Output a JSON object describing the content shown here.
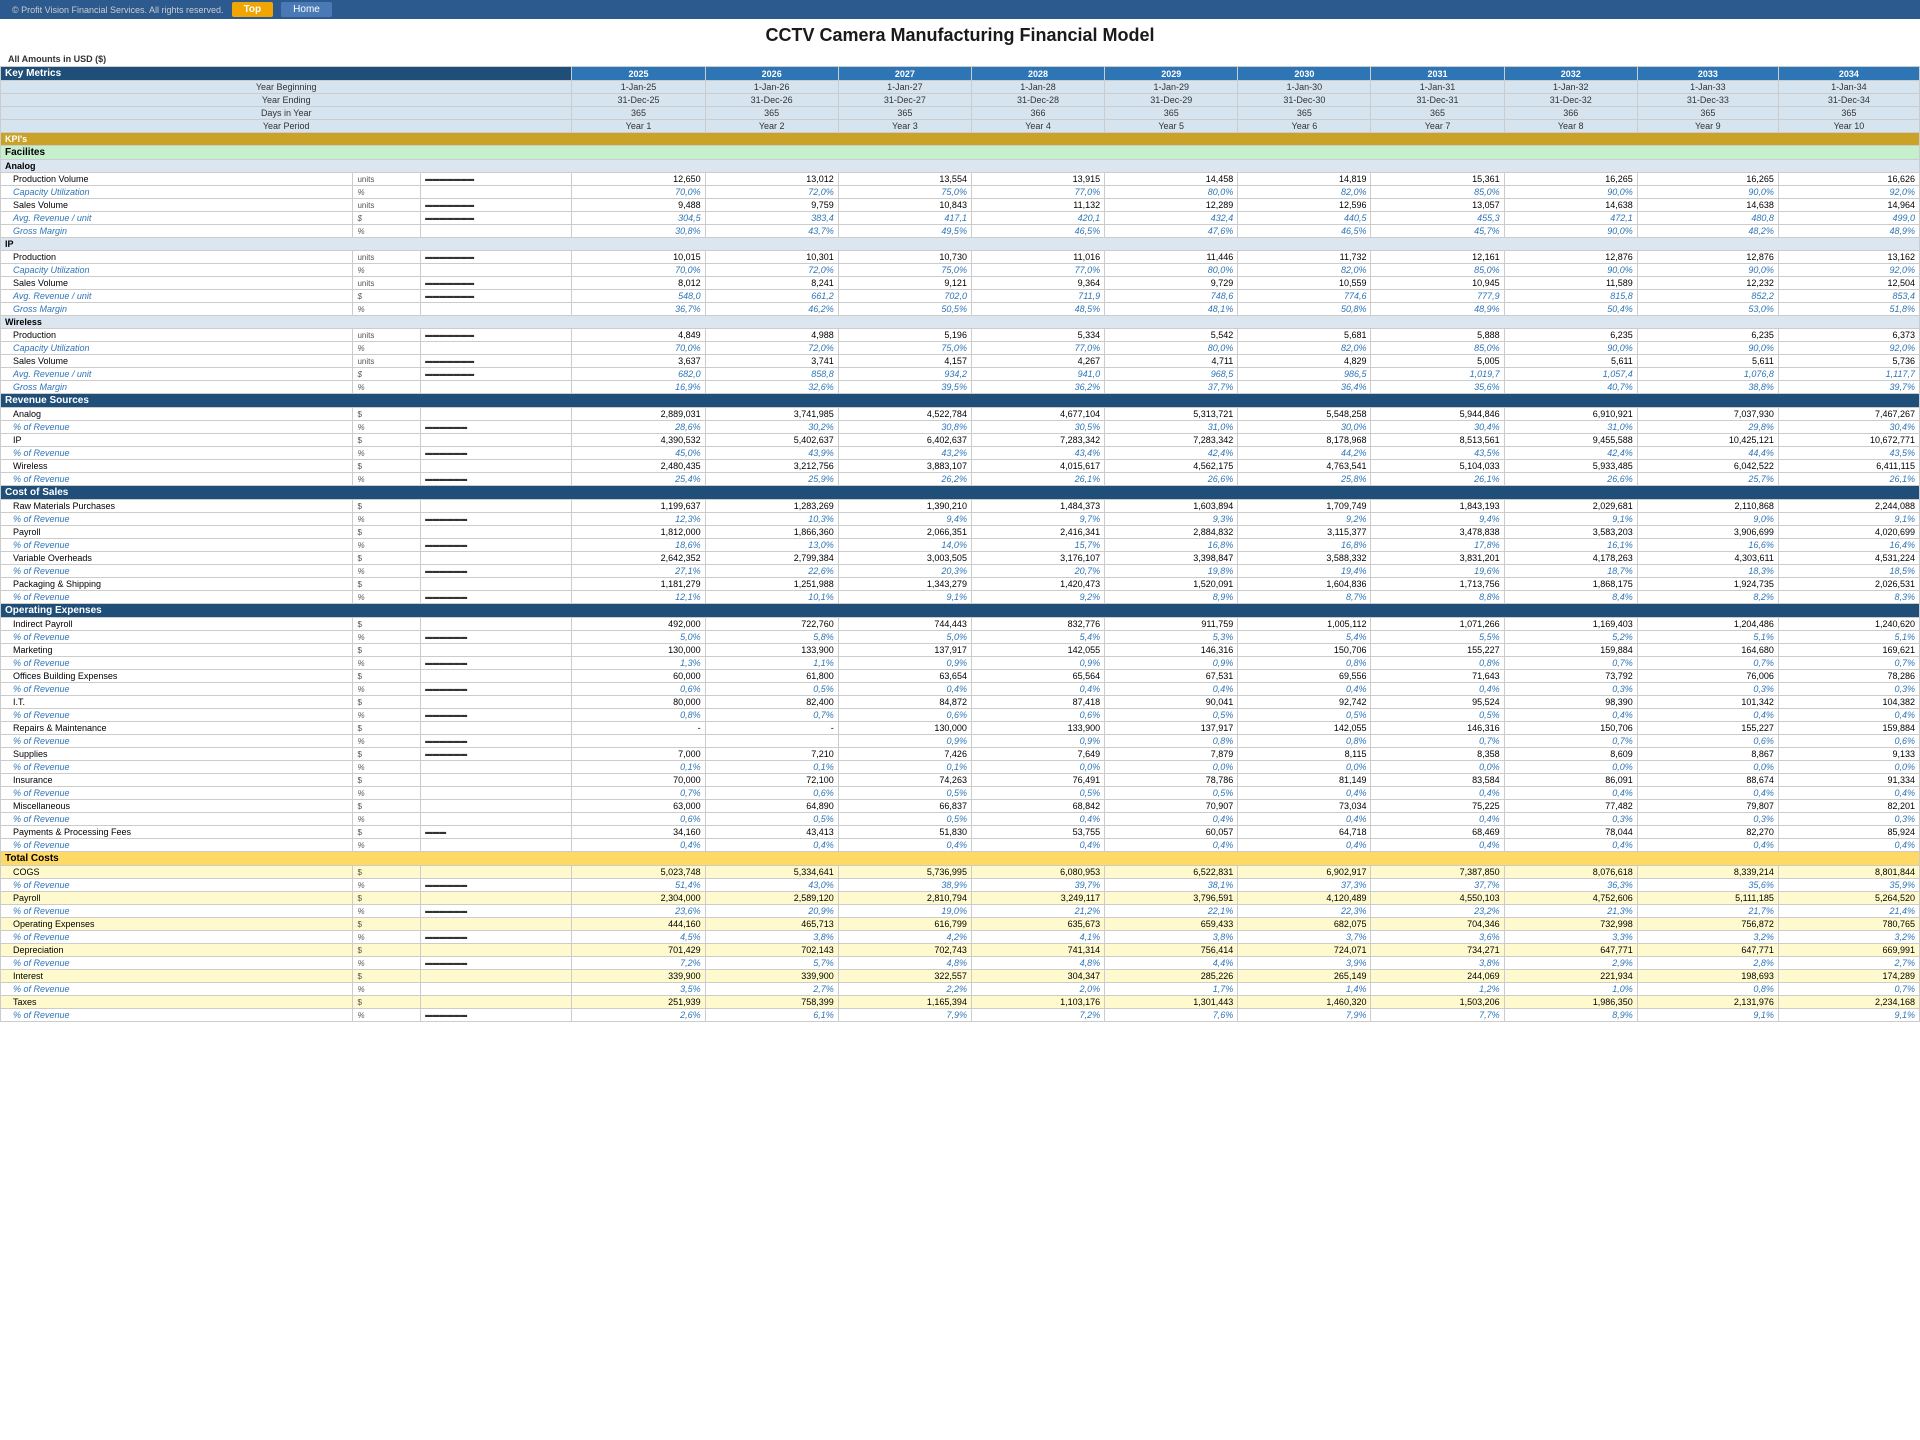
{
  "copyright": "© Profit Vision Financial Services. All rights reserved.",
  "buttons": {
    "top": "Top",
    "home": "Home"
  },
  "title": "CCTV Camera Manufacturing Financial Model",
  "currency": "All Amounts in USD ($)",
  "years": [
    "2025",
    "2026",
    "2027",
    "2028",
    "2029",
    "2030",
    "2031",
    "2032",
    "2033",
    "2034"
  ],
  "year_beginning": [
    "1-Jan-25",
    "1-Jan-26",
    "1-Jan-27",
    "1-Jan-28",
    "1-Jan-29",
    "1-Jan-30",
    "1-Jan-31",
    "1-Jan-32",
    "1-Jan-33",
    "1-Jan-34"
  ],
  "year_ending": [
    "31-Dec-25",
    "31-Dec-26",
    "31-Dec-27",
    "31-Dec-28",
    "31-Dec-29",
    "31-Dec-30",
    "31-Dec-31",
    "31-Dec-32",
    "31-Dec-33",
    "31-Dec-34"
  ],
  "days_in_year": [
    "365",
    "365",
    "365",
    "366",
    "365",
    "365",
    "365",
    "366",
    "365",
    "365"
  ],
  "year_period": [
    "Year 1",
    "Year 2",
    "Year 3",
    "Year 4",
    "Year 5",
    "Year 6",
    "Year 7",
    "Year 8",
    "Year 9",
    "Year 10"
  ],
  "sections": {
    "key_metrics": "Key Metrics",
    "kpis": "KPI's",
    "facilities": "Facilites",
    "analog": "Analog",
    "ip": "IP",
    "wireless": "Wireless",
    "revenue_sources": "Revenue Sources",
    "cost_of_sales": "Cost of Sales",
    "operating_expenses": "Operating Expenses",
    "total_costs": "Total Costs"
  },
  "analog": {
    "production": {
      "label": "Production Volume",
      "unit": "units",
      "values": [
        "12,650",
        "13,012",
        "13,554",
        "13,915",
        "14,458",
        "14,819",
        "15,361",
        "16,265",
        "16,265",
        "16,626"
      ]
    },
    "capacity": {
      "label": "Capacity Utilization",
      "unit": "%",
      "values": [
        "70,0%",
        "72,0%",
        "75,0%",
        "77,0%",
        "80,0%",
        "82,0%",
        "85,0%",
        "90,0%",
        "90,0%",
        "92,0%"
      ]
    },
    "sales_volume": {
      "label": "Sales Volume",
      "unit": "units",
      "values": [
        "9,488",
        "9,759",
        "10,843",
        "11,132",
        "12,289",
        "12,596",
        "13,057",
        "14,638",
        "14,638",
        "14,964"
      ]
    },
    "avg_revenue": {
      "label": "Avg. Revenue / unit",
      "unit": "$",
      "values": [
        "304,5",
        "383,4",
        "417,1",
        "420,1",
        "432,4",
        "440,5",
        "455,3",
        "472,1",
        "480,8",
        "499,0"
      ]
    },
    "gross_margin": {
      "label": "Gross Margin",
      "unit": "%",
      "values": [
        "30,8%",
        "43,7%",
        "49,5%",
        "46,5%",
        "47,6%",
        "46,5%",
        "45,7%",
        "90,0%",
        "48,2%",
        "48,9%"
      ]
    }
  },
  "ip": {
    "production": {
      "label": "Production",
      "unit": "units",
      "values": [
        "10,015",
        "10,301",
        "10,730",
        "11,016",
        "11,446",
        "11,732",
        "12,161",
        "12,876",
        "12,876",
        "13,162"
      ]
    },
    "capacity": {
      "label": "Capacity Utilization",
      "unit": "%",
      "values": [
        "70,0%",
        "72,0%",
        "75,0%",
        "77,0%",
        "80,0%",
        "82,0%",
        "85,0%",
        "90,0%",
        "90,0%",
        "92,0%"
      ]
    },
    "sales_volume": {
      "label": "Sales Volume",
      "unit": "units",
      "values": [
        "8,012",
        "8,241",
        "9,121",
        "9,364",
        "9,729",
        "10,559",
        "10,945",
        "11,589",
        "12,232",
        "12,504"
      ]
    },
    "avg_revenue": {
      "label": "Avg. Revenue / unit",
      "unit": "$",
      "values": [
        "548,0",
        "661,2",
        "702,0",
        "711,9",
        "748,6",
        "774,6",
        "777,9",
        "815,8",
        "852,2",
        "853,4"
      ]
    },
    "gross_margin": {
      "label": "Gross Margin",
      "unit": "%",
      "values": [
        "36,7%",
        "46,2%",
        "50,5%",
        "48,5%",
        "48,1%",
        "50,8%",
        "48,9%",
        "50,4%",
        "53,0%",
        "51,8%"
      ]
    }
  },
  "wireless": {
    "production": {
      "label": "Production",
      "unit": "units",
      "values": [
        "4,849",
        "4,988",
        "5,196",
        "5,334",
        "5,542",
        "5,681",
        "5,888",
        "6,235",
        "6,235",
        "6,373"
      ]
    },
    "capacity": {
      "label": "Capacity Utilization",
      "unit": "%",
      "values": [
        "70,0%",
        "72,0%",
        "75,0%",
        "77,0%",
        "80,0%",
        "82,0%",
        "85,0%",
        "90,0%",
        "90,0%",
        "92,0%"
      ]
    },
    "sales_volume": {
      "label": "Sales Volume",
      "unit": "units",
      "values": [
        "3,637",
        "3,741",
        "4,157",
        "4,267",
        "4,711",
        "4,829",
        "5,005",
        "5,611",
        "5,611",
        "5,736"
      ]
    },
    "avg_revenue": {
      "label": "Avg. Revenue / unit",
      "unit": "$",
      "values": [
        "682,0",
        "858,8",
        "934,2",
        "941,0",
        "968,5",
        "986,5",
        "1,019,7",
        "1,057,4",
        "1,076,8",
        "1,117,7"
      ]
    },
    "gross_margin": {
      "label": "Gross Margin",
      "unit": "%",
      "values": [
        "16,9%",
        "32,6%",
        "39,5%",
        "36,2%",
        "37,7%",
        "36,4%",
        "35,6%",
        "40,7%",
        "38,8%",
        "39,7%"
      ]
    }
  },
  "revenue": {
    "analog": {
      "label": "Analog",
      "unit": "$",
      "pct_label": "% of Revenue",
      "values": [
        "2,889,031",
        "3,741,985",
        "4,522,784",
        "4,677,104",
        "5,313,721",
        "5,548,258",
        "5,944,846",
        "6,910,921",
        "7,037,930",
        "7,467,267"
      ],
      "pct": [
        "28,6%",
        "30,2%",
        "30,8%",
        "30,5%",
        "31,0%",
        "30,0%",
        "30,4%",
        "31,0%",
        "29,8%",
        "30,4%"
      ]
    },
    "ip": {
      "label": "IP",
      "unit": "$",
      "pct_label": "% of Revenue",
      "values": [
        "4,390,532",
        "5,402,637",
        "6,402,637",
        "7,283,342",
        "7,283,342",
        "8,178,968",
        "8,513,561",
        "9,455,588",
        "10,425,121",
        "10,672,771"
      ],
      "pct": [
        "45,0%",
        "43,9%",
        "43,2%",
        "43,4%",
        "42,4%",
        "44,2%",
        "43,5%",
        "42,4%",
        "44,4%",
        "43,5%"
      ]
    },
    "wireless": {
      "label": "Wireless",
      "unit": "$",
      "pct_label": "% of Revenue",
      "values": [
        "2,480,435",
        "3,212,756",
        "3,883,107",
        "4,015,617",
        "4,562,175",
        "4,763,541",
        "5,104,033",
        "5,933,485",
        "6,042,522",
        "6,411,115"
      ],
      "pct": [
        "25,4%",
        "25,9%",
        "26,2%",
        "26,1%",
        "26,6%",
        "25,8%",
        "26,1%",
        "26,6%",
        "25,7%",
        "26,1%"
      ]
    }
  },
  "cos": {
    "raw_materials": {
      "label": "Raw Materials Purchases",
      "unit": "$",
      "pct_label": "% of Revenue",
      "values": [
        "1,199,637",
        "1,283,269",
        "1,390,210",
        "1,484,373",
        "1,603,894",
        "1,709,749",
        "1,843,193",
        "2,029,681",
        "2,110,868",
        "2,244,088"
      ],
      "pct": [
        "12,3%",
        "10,3%",
        "9,4%",
        "9,7%",
        "9,3%",
        "9,2%",
        "9,4%",
        "9,1%",
        "9,0%",
        "9,1%"
      ]
    },
    "payroll": {
      "label": "Payroll",
      "unit": "$",
      "pct_label": "% of Revenue",
      "values": [
        "1,812,000",
        "1,866,360",
        "2,066,351",
        "2,416,341",
        "2,884,832",
        "3,115,377",
        "3,478,838",
        "3,583,203",
        "3,906,699",
        "4,020,699"
      ],
      "pct": [
        "18,6%",
        "13,0%",
        "14,0%",
        "15,7%",
        "16,8%",
        "16,8%",
        "17,8%",
        "16,1%",
        "16,6%",
        "16,4%"
      ]
    },
    "variable_overheads": {
      "label": "Variable Overheads",
      "unit": "$",
      "pct_label": "% of Revenue",
      "values": [
        "2,642,352",
        "2,799,384",
        "3,003,505",
        "3,176,107",
        "3,398,847",
        "3,588,332",
        "3,831,201",
        "4,178,263",
        "4,303,611",
        "4,531,224"
      ],
      "pct": [
        "27,1%",
        "22,6%",
        "20,3%",
        "20,7%",
        "19,8%",
        "19,4%",
        "19,6%",
        "18,7%",
        "18,3%",
        "18,5%"
      ]
    },
    "packaging": {
      "label": "Packaging & Shipping",
      "unit": "$",
      "pct_label": "% of Revenue",
      "values": [
        "1,181,279",
        "1,251,988",
        "1,343,279",
        "1,420,473",
        "1,520,091",
        "1,604,836",
        "1,713,756",
        "1,868,175",
        "1,924,735",
        "2,026,531"
      ],
      "pct": [
        "12,1%",
        "10,1%",
        "9,1%",
        "9,2%",
        "8,9%",
        "8,7%",
        "8,8%",
        "8,4%",
        "8,2%",
        "8,3%"
      ]
    }
  },
  "opex": {
    "indirect_payroll": {
      "label": "Indirect Payroll",
      "unit": "$",
      "pct_label": "% of Revenue",
      "values": [
        "492,000",
        "722,760",
        "744,443",
        "832,776",
        "911,759",
        "1,005,112",
        "1,071,266",
        "1,169,403",
        "1,204,486",
        "1,240,620"
      ],
      "pct": [
        "5,0%",
        "5,8%",
        "5,0%",
        "5,4%",
        "5,3%",
        "5,4%",
        "5,5%",
        "5,2%",
        "5,1%",
        "5,1%"
      ]
    },
    "marketing": {
      "label": "Marketing",
      "unit": "$",
      "pct_label": "% of Revenue",
      "values": [
        "130,000",
        "133,900",
        "137,917",
        "142,055",
        "146,316",
        "150,706",
        "155,227",
        "159,884",
        "164,680",
        "169,621"
      ],
      "pct": [
        "1,3%",
        "1,1%",
        "0,9%",
        "0,9%",
        "0,9%",
        "0,8%",
        "0,8%",
        "0,7%",
        "0,7%",
        "0,7%"
      ]
    },
    "offices": {
      "label": "Offices Building Expenses",
      "unit": "$",
      "pct_label": "% of Revenue",
      "values": [
        "60,000",
        "61,800",
        "63,654",
        "65,564",
        "67,531",
        "69,556",
        "71,643",
        "73,792",
        "76,006",
        "78,286"
      ],
      "pct": [
        "0,6%",
        "0,5%",
        "0,4%",
        "0,4%",
        "0,4%",
        "0,4%",
        "0,4%",
        "0,3%",
        "0,3%",
        "0,3%"
      ]
    },
    "it": {
      "label": "I.T.",
      "unit": "$",
      "pct_label": "% of Revenue",
      "values": [
        "80,000",
        "82,400",
        "84,872",
        "87,418",
        "90,041",
        "92,742",
        "95,524",
        "98,390",
        "101,342",
        "104,382"
      ],
      "pct": [
        "0,8%",
        "0,7%",
        "0,6%",
        "0,6%",
        "0,5%",
        "0,5%",
        "0,5%",
        "0,4%",
        "0,4%",
        "0,4%"
      ]
    },
    "repairs": {
      "label": "Repairs & Maintenance",
      "unit": "$",
      "pct_label": "% of Revenue",
      "values": [
        "-",
        "-",
        "130,000",
        "133,900",
        "137,917",
        "142,055",
        "146,316",
        "150,706",
        "155,227",
        "159,884"
      ],
      "pct": [
        "",
        "",
        "0,9%",
        "0,9%",
        "0,8%",
        "0,8%",
        "0,7%",
        "0,7%",
        "0,6%",
        "0,6%"
      ]
    },
    "supplies": {
      "label": "Supplies",
      "unit": "$",
      "pct_label": "% of Revenue",
      "values": [
        "7,000",
        "7,210",
        "7,426",
        "7,649",
        "7,879",
        "8,115",
        "8,358",
        "8,609",
        "8,867",
        "9,133"
      ],
      "pct": [
        "0,1%",
        "0,1%",
        "0,1%",
        "0,0%",
        "0,0%",
        "0,0%",
        "0,0%",
        "0,0%",
        "0,0%",
        "0,0%"
      ]
    },
    "insurance": {
      "label": "Insurance",
      "unit": "$",
      "pct_label": "% of Revenue",
      "values": [
        "70,000",
        "72,100",
        "74,263",
        "76,491",
        "78,786",
        "81,149",
        "83,584",
        "86,091",
        "88,674",
        "91,334"
      ],
      "pct": [
        "0,7%",
        "0,6%",
        "0,5%",
        "0,5%",
        "0,5%",
        "0,4%",
        "0,4%",
        "0,4%",
        "0,4%",
        "0,4%"
      ]
    },
    "miscellaneous": {
      "label": "Miscellaneous",
      "unit": "$",
      "pct_label": "% of Revenue",
      "values": [
        "63,000",
        "64,890",
        "66,837",
        "68,842",
        "70,907",
        "73,034",
        "75,225",
        "77,482",
        "79,807",
        "82,201"
      ],
      "pct": [
        "0,6%",
        "0,5%",
        "0,5%",
        "0,4%",
        "0,4%",
        "0,4%",
        "0,4%",
        "0,3%",
        "0,3%",
        "0,3%"
      ]
    },
    "payments": {
      "label": "Payments & Processing Fees",
      "unit": "$",
      "pct_label": "% of Revenue",
      "values": [
        "34,160",
        "43,413",
        "51,830",
        "53,755",
        "60,057",
        "64,718",
        "68,469",
        "78,044",
        "82,270",
        "85,924"
      ],
      "pct": [
        "0,4%",
        "0,4%",
        "0,4%",
        "0,4%",
        "0,4%",
        "0,4%",
        "0,4%",
        "0,4%",
        "0,4%",
        "0,4%"
      ]
    }
  },
  "total_costs": {
    "cogs": {
      "label": "COGS",
      "unit": "$",
      "pct_label": "% of Revenue",
      "values": [
        "5,023,748",
        "5,334,641",
        "5,736,995",
        "6,080,953",
        "6,522,831",
        "6,902,917",
        "7,387,850",
        "8,076,618",
        "8,339,214",
        "8,801,844"
      ],
      "pct": [
        "51,4%",
        "43,0%",
        "38,9%",
        "39,7%",
        "38,1%",
        "37,3%",
        "37,7%",
        "36,3%",
        "35,6%",
        "35,9%"
      ]
    },
    "payroll_total": {
      "label": "Payroll",
      "unit": "$",
      "pct_label": "% of Revenue",
      "values": [
        "2,304,000",
        "2,589,120",
        "2,810,794",
        "3,249,117",
        "3,796,591",
        "4,120,489",
        "4,550,103",
        "4,752,606",
        "5,111,185",
        "5,264,520"
      ],
      "pct": [
        "23,6%",
        "20,9%",
        "19,0%",
        "21,2%",
        "22,1%",
        "22,3%",
        "23,2%",
        "21,3%",
        "21,7%",
        "21,4%"
      ]
    },
    "operating_expenses": {
      "label": "Operating Expenses",
      "unit": "$",
      "pct_label": "% of Revenue",
      "values": [
        "444,160",
        "465,713",
        "616,799",
        "635,673",
        "659,433",
        "682,075",
        "704,346",
        "732,998",
        "756,872",
        "780,765"
      ],
      "pct": [
        "4,5%",
        "3,8%",
        "4,2%",
        "4,1%",
        "3,8%",
        "3,7%",
        "3,6%",
        "3,3%",
        "3,2%",
        "3,2%"
      ]
    },
    "depreciation": {
      "label": "Depreciation",
      "unit": "$",
      "pct_label": "% of Revenue",
      "values": [
        "701,429",
        "702,143",
        "702,743",
        "741,314",
        "756,414",
        "724,071",
        "734,271",
        "647,771",
        "647,771",
        "669,991"
      ],
      "pct": [
        "7,2%",
        "5,7%",
        "4,8%",
        "4,8%",
        "4,4%",
        "3,9%",
        "3,8%",
        "2,9%",
        "2,8%",
        "2,7%"
      ]
    },
    "interest": {
      "label": "Interest",
      "unit": "$",
      "pct_label": "% of Revenue",
      "values": [
        "339,900",
        "339,900",
        "322,557",
        "304,347",
        "285,226",
        "265,149",
        "244,069",
        "221,934",
        "198,693",
        "174,289"
      ],
      "pct": [
        "3,5%",
        "2,7%",
        "2,2%",
        "2,0%",
        "1,7%",
        "1,4%",
        "1,2%",
        "1,0%",
        "0,8%",
        "0,7%"
      ]
    },
    "taxes": {
      "label": "Taxes",
      "unit": "$",
      "pct_label": "% of Revenue",
      "values": [
        "251,939",
        "758,399",
        "1,165,394",
        "1,103,176",
        "1,301,443",
        "1,460,320",
        "1,503,206",
        "1,986,350",
        "2,131,976",
        "2,234,168"
      ],
      "pct": [
        "2,6%",
        "6,1%",
        "7,9%",
        "7,2%",
        "7,6%",
        "7,9%",
        "7,7%",
        "8,9%",
        "9,1%",
        "9,1%"
      ]
    }
  }
}
